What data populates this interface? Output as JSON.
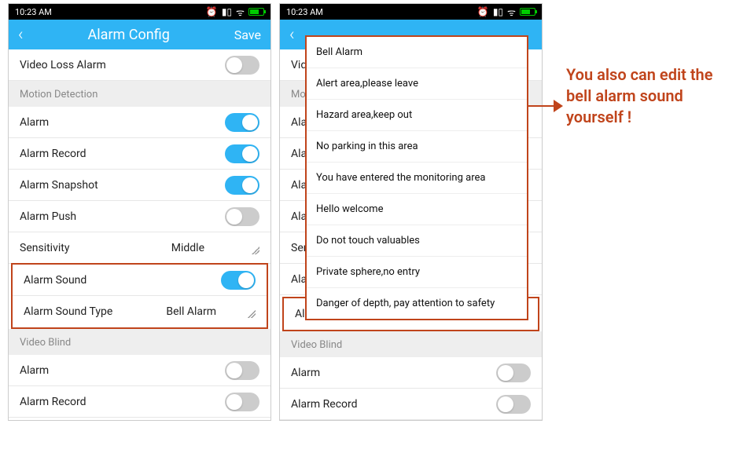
{
  "status": {
    "time": "10:23 AM"
  },
  "header": {
    "title": "Alarm Config",
    "save": "Save"
  },
  "rows": {
    "video_loss": "Video Loss Alarm",
    "motion_detection": "Motion Detection",
    "alarm": "Alarm",
    "alarm_record": "Alarm Record",
    "alarm_snapshot": "Alarm Snapshot",
    "alarm_push": "Alarm Push",
    "sensitivity": "Sensitivity",
    "sensitivity_value": "Middle",
    "alarm_sound": "Alarm Sound",
    "alarm_sound_type": "Alarm Sound Type",
    "alarm_sound_type_value": "Bell Alarm",
    "video_blind": "Video Blind"
  },
  "popup": {
    "items": [
      "Bell Alarm",
      "Alert area,please leave",
      "Hazard area,keep out",
      "No parking in this area",
      "You have entered the monitoring area",
      "Hello welcome",
      "Do not touch valuables",
      "Private sphere,no entry",
      "Danger of depth, pay attention to safety"
    ]
  },
  "annotation": "You also can edit the bell alarm sound yourself !",
  "phone2_partial": {
    "video": "Video",
    "motio": "Motio",
    "alarm": "Alarm",
    "sensit": "Sensit"
  }
}
